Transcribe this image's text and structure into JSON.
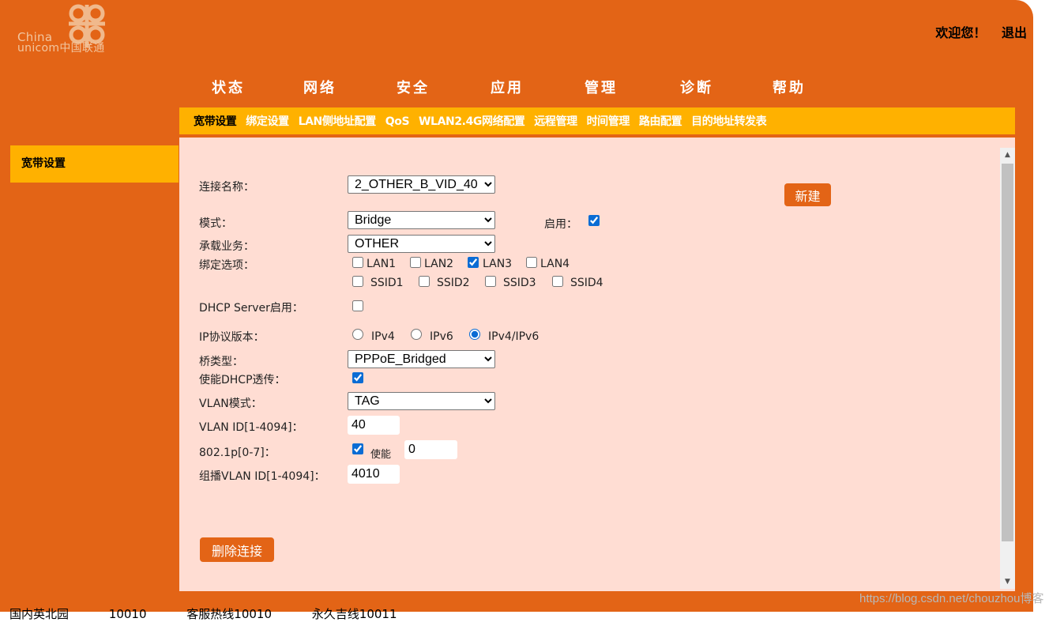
{
  "logo": {
    "line1": "China",
    "line2": "unicom中国联通"
  },
  "header": {
    "welcome": "欢迎您！",
    "logout": "退出"
  },
  "main_nav": [
    "状态",
    "网络",
    "安全",
    "应用",
    "管理",
    "诊断",
    "帮助"
  ],
  "sub_nav": [
    "宽带设置",
    "绑定设置",
    "LAN侧地址配置",
    "QoS",
    "WLAN2.4G网络配置",
    "远程管理",
    "时间管理",
    "路由配置",
    "目的地址转发表"
  ],
  "sub_nav_active": "宽带设置",
  "side_menu": {
    "item": "宽带设置"
  },
  "form": {
    "connection_name_label": "连接名称：",
    "connection_name_value": "2_OTHER_B_VID_40",
    "new_button": "新建",
    "mode_label": "模式：",
    "mode_value": "Bridge",
    "enable_label": "启用：",
    "enable_checked": true,
    "service_label": "承载业务：",
    "service_value": "OTHER",
    "binding_label": "绑定选项：",
    "binding_options": [
      {
        "label": "LAN1",
        "checked": false
      },
      {
        "label": "LAN2",
        "checked": false
      },
      {
        "label": "LAN3",
        "checked": true
      },
      {
        "label": "LAN4",
        "checked": false
      },
      {
        "label": "SSID1",
        "checked": false
      },
      {
        "label": "SSID2",
        "checked": false
      },
      {
        "label": "SSID3",
        "checked": false
      },
      {
        "label": "SSID4",
        "checked": false
      }
    ],
    "dhcp_server_label": "DHCP Server启用：",
    "dhcp_server_checked": false,
    "ip_version_label": "IP协议版本：",
    "ip_versions": [
      "IPv4",
      "IPv6",
      "IPv4/IPv6"
    ],
    "ip_version_selected": "IPv4/IPv6",
    "bridge_type_label": "桥类型：",
    "bridge_type_value": "PPPoE_Bridged",
    "dhcp_passthrough_label": "使能DHCP透传：",
    "dhcp_passthrough_checked": true,
    "vlan_mode_label": "VLAN模式：",
    "vlan_mode_value": "TAG",
    "vlan_id_label": "VLAN ID[1-4094]：",
    "vlan_id_value": "40",
    "dot1p_label": "802.1p[0-7]：",
    "dot1p_enable_label": "使能",
    "dot1p_enable_checked": true,
    "dot1p_value": "0",
    "mcast_vlan_label": "组播VLAN ID[1-4094]：",
    "mcast_vlan_value": "4010",
    "delete_button": "删除连接"
  },
  "footer": [
    "国内英北园",
    "10010",
    "客服热线10010",
    "永久吉线10011"
  ],
  "watermark": "https://blog.csdn.net/chouzhou博客",
  "colors": {
    "frame": "#E36416",
    "accent": "#FFB100",
    "content_bg": "#FFDDD3"
  }
}
